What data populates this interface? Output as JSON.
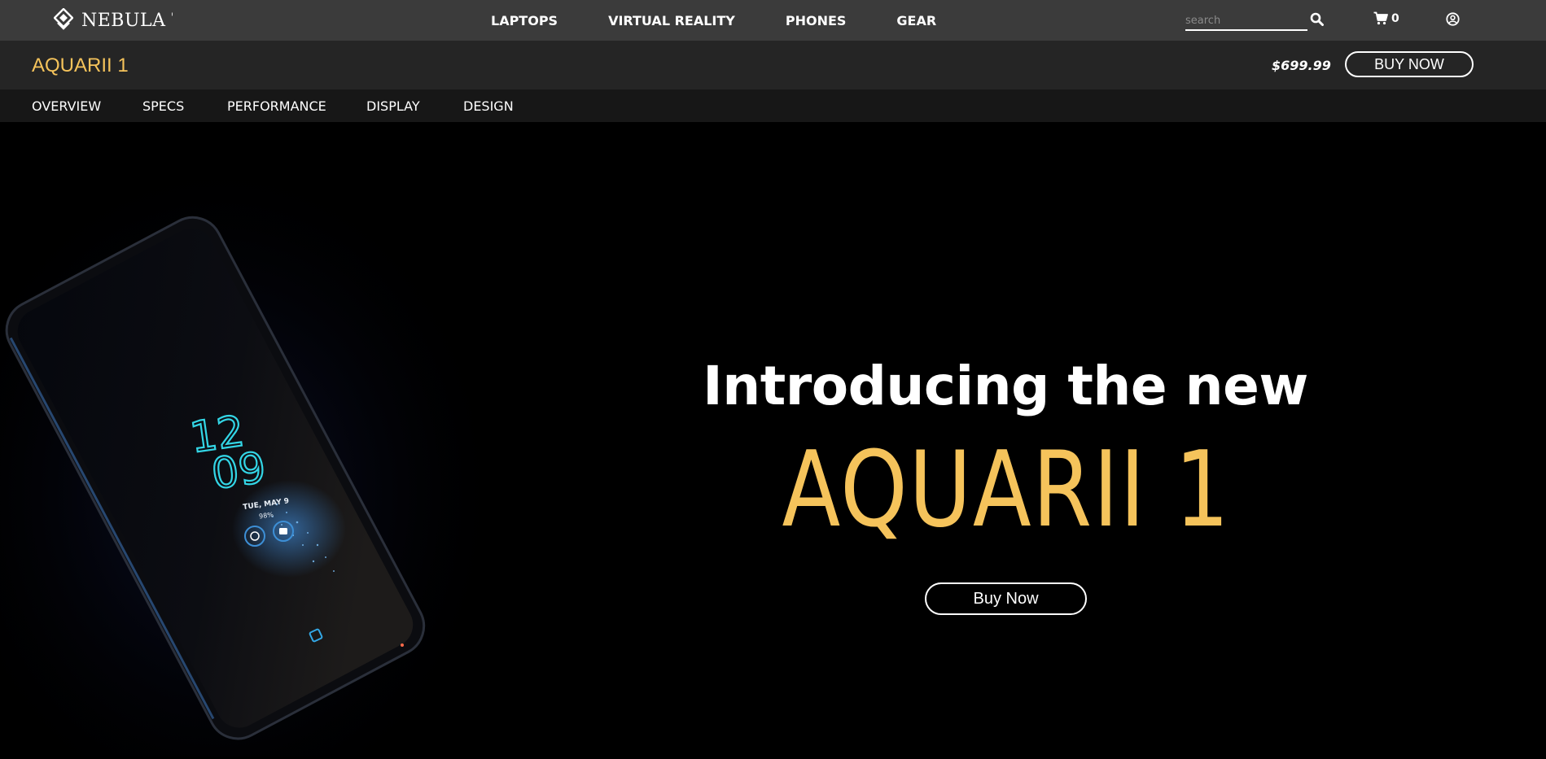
{
  "brand": {
    "name": "NEBULA T"
  },
  "main_nav": {
    "items": [
      {
        "label": "LAPTOPS"
      },
      {
        "label": "VIRTUAL REALITY"
      },
      {
        "label": "PHONES"
      },
      {
        "label": "GEAR"
      }
    ]
  },
  "search": {
    "placeholder": "search",
    "value": ""
  },
  "cart": {
    "count": "0"
  },
  "product_bar": {
    "title": "AQUARII 1",
    "price": "$699.99",
    "buy_label": "BUY NOW"
  },
  "sub_nav": {
    "items": [
      {
        "label": "OVERVIEW"
      },
      {
        "label": "SPECS"
      },
      {
        "label": "PERFORMANCE"
      },
      {
        "label": "DISPLAY"
      },
      {
        "label": "DESIGN"
      }
    ]
  },
  "hero": {
    "headline": "Introducing the new",
    "product_name": "AQUARII 1",
    "buy_label": "Buy Now",
    "phone_screen": {
      "hour": "12",
      "minute": "09",
      "date": "TUE, MAY 9",
      "battery": "98%"
    }
  },
  "colors": {
    "accent": "#f5c35b",
    "topbar": "#3b3b3b",
    "productbar": "#252525",
    "subnav": "#171717",
    "background": "#000000",
    "phone_glow": "#33d6e6"
  },
  "icons": [
    "nebula-logo-icon",
    "search-icon",
    "cart-icon",
    "user-circle-icon"
  ]
}
